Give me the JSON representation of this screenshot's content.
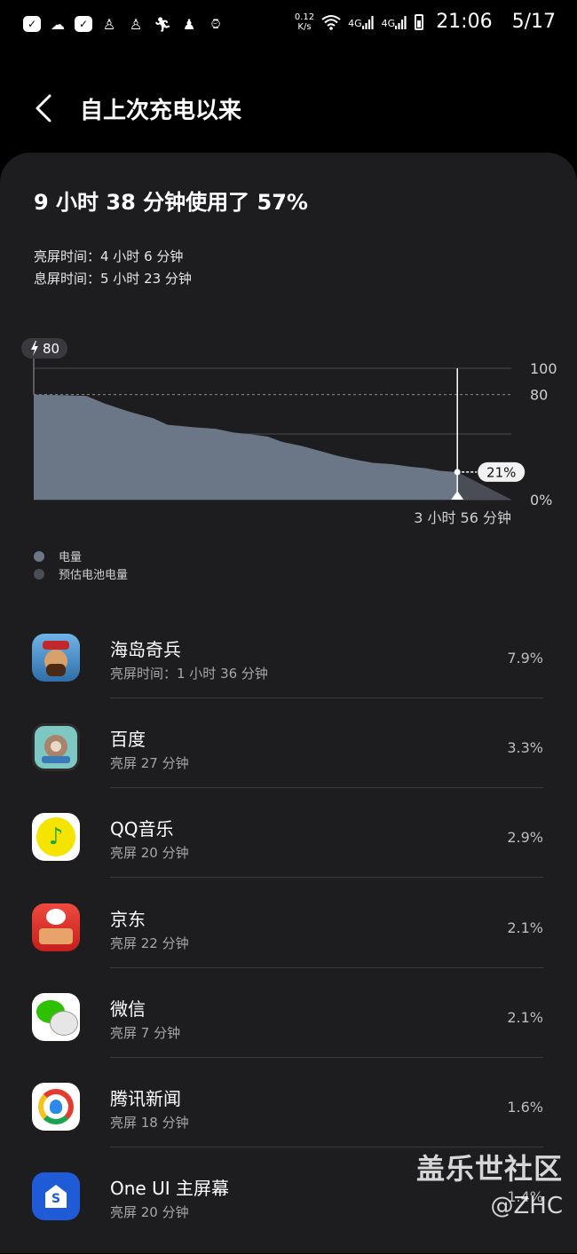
{
  "status_bar": {
    "net_speed": "0.12",
    "net_unit": "K/s",
    "signal1": "4G",
    "signal2": "4G",
    "time": "21:06",
    "date": "5/17"
  },
  "header": {
    "title": "自上次充电以来"
  },
  "summary": {
    "headline": "9 小时 38 分钟使用了 57%",
    "screen_on": "亮屏时间：4 小时 6 分钟",
    "screen_off": "息屏时间：5 小时 23 分钟"
  },
  "chart_data": {
    "type": "area",
    "start_badge": "80",
    "y_ticks": [
      "100",
      "80",
      "0%"
    ],
    "ylim": [
      0,
      100
    ],
    "cursor_label": "21%",
    "remaining_label": "3 小时 56 分钟",
    "series": [
      {
        "name": "电量",
        "color": "#6b7686",
        "x": [
          0,
          0.06,
          0.11,
          0.15,
          0.2,
          0.25,
          0.28,
          0.34,
          0.38,
          0.42,
          0.45,
          0.49,
          0.52,
          0.56,
          0.6,
          0.64,
          0.68,
          0.71,
          0.75,
          0.79,
          0.82,
          0.85,
          0.887
        ],
        "y": [
          80,
          79.5,
          79,
          73,
          67,
          62,
          57,
          55,
          54,
          51,
          50,
          48,
          44,
          41,
          37,
          33,
          30,
          28,
          27,
          25,
          24,
          22,
          21
        ]
      },
      {
        "name": "预估电池电量",
        "color": "#4a4d55",
        "x": [
          0.887,
          1.0
        ],
        "y": [
          21,
          0
        ]
      }
    ]
  },
  "apps": [
    {
      "name": "海岛奇兵",
      "sub": "亮屏时间：1 小时 36 分钟",
      "pct": "7.9%",
      "icon": "boom-beach-icon"
    },
    {
      "name": "百度",
      "sub": "亮屏 27 分钟",
      "pct": "3.3%",
      "icon": "baidu-icon"
    },
    {
      "name": "QQ音乐",
      "sub": "亮屏 20 分钟",
      "pct": "2.9%",
      "icon": "qq-music-icon"
    },
    {
      "name": "京东",
      "sub": "亮屏 22 分钟",
      "pct": "2.1%",
      "icon": "jd-icon"
    },
    {
      "name": "微信",
      "sub": "亮屏 7 分钟",
      "pct": "2.1%",
      "icon": "wechat-icon"
    },
    {
      "name": "腾讯新闻",
      "sub": "亮屏 18 分钟",
      "pct": "1.6%",
      "icon": "tencent-news-icon"
    },
    {
      "name": "One UI 主屏幕",
      "sub": "亮屏 20 分钟",
      "pct": "1.4%",
      "icon": "one-ui-home-icon"
    }
  ],
  "watermark": {
    "line1": "盖乐世社区",
    "line2": "@ZHC"
  }
}
